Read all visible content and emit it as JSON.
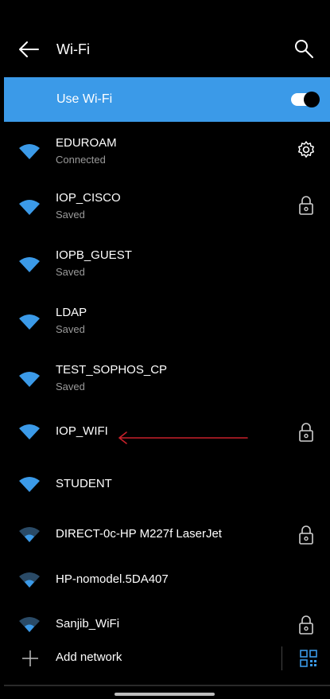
{
  "header": {
    "title": "Wi-Fi"
  },
  "use_wifi": {
    "label": "Use Wi-Fi",
    "enabled": true
  },
  "networks": [
    {
      "name": "EDUROAM",
      "status": "Connected",
      "trailing": "gear-icon",
      "signal": "full"
    },
    {
      "name": "IOP_CISCO",
      "status": "Saved",
      "trailing": "lock-icon",
      "signal": "full"
    },
    {
      "name": "IOPB_GUEST",
      "status": "Saved",
      "trailing": "",
      "signal": "full"
    },
    {
      "name": "LDAP",
      "status": "Saved",
      "trailing": "",
      "signal": "full"
    },
    {
      "name": "TEST_SOPHOS_CP",
      "status": "Saved",
      "trailing": "",
      "signal": "full"
    },
    {
      "name": "IOP_WIFI",
      "status": "",
      "trailing": "lock-icon",
      "signal": "full"
    },
    {
      "name": "STUDENT",
      "status": "",
      "trailing": "",
      "signal": "full"
    },
    {
      "name": "DIRECT-0c-HP M227f LaserJet",
      "status": "",
      "trailing": "lock-icon",
      "signal": "weak"
    },
    {
      "name": "HP-nomodel.5DA407",
      "status": "",
      "trailing": "",
      "signal": "weak"
    },
    {
      "name": "Sanjib_WiFi",
      "status": "",
      "trailing": "lock-icon",
      "signal": "weak"
    }
  ],
  "add_network": {
    "label": "Add network"
  },
  "colors": {
    "accent": "#3b9ae8",
    "arrow": "#c8202a",
    "background": "#000000"
  }
}
